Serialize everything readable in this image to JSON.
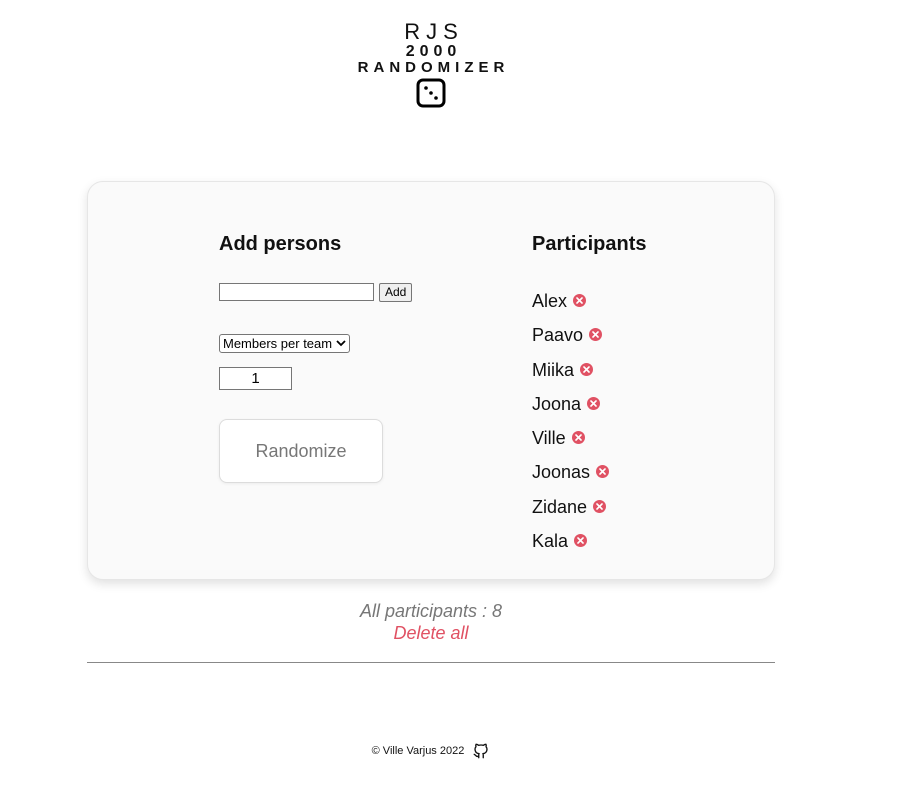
{
  "logo": {
    "line1": "RJS",
    "line2": "2000",
    "line3": "RANDOMIZER",
    "icon": "dice-icon"
  },
  "add_section": {
    "title": "Add persons",
    "name_input_value": "",
    "add_label": "Add",
    "mode_select_value": "Members per team",
    "count_value": "1",
    "randomize_label": "Randomize"
  },
  "participants_section": {
    "title": "Participants",
    "remove_icon": "remove-icon",
    "items": [
      {
        "name": "Alex"
      },
      {
        "name": "Paavo"
      },
      {
        "name": "Miika"
      },
      {
        "name": "Joona"
      },
      {
        "name": "Ville"
      },
      {
        "name": "Joonas"
      },
      {
        "name": "Zidane"
      },
      {
        "name": "Kala"
      }
    ]
  },
  "summary": {
    "all_participants_text": "All participants : 8",
    "delete_all_label": "Delete all"
  },
  "footer": {
    "copyright": "© Ville Varjus 2022",
    "github_icon": "github-icon"
  },
  "colors": {
    "accent_red": "#e05163",
    "muted_text": "#777777",
    "card_background": "#fafafa"
  }
}
